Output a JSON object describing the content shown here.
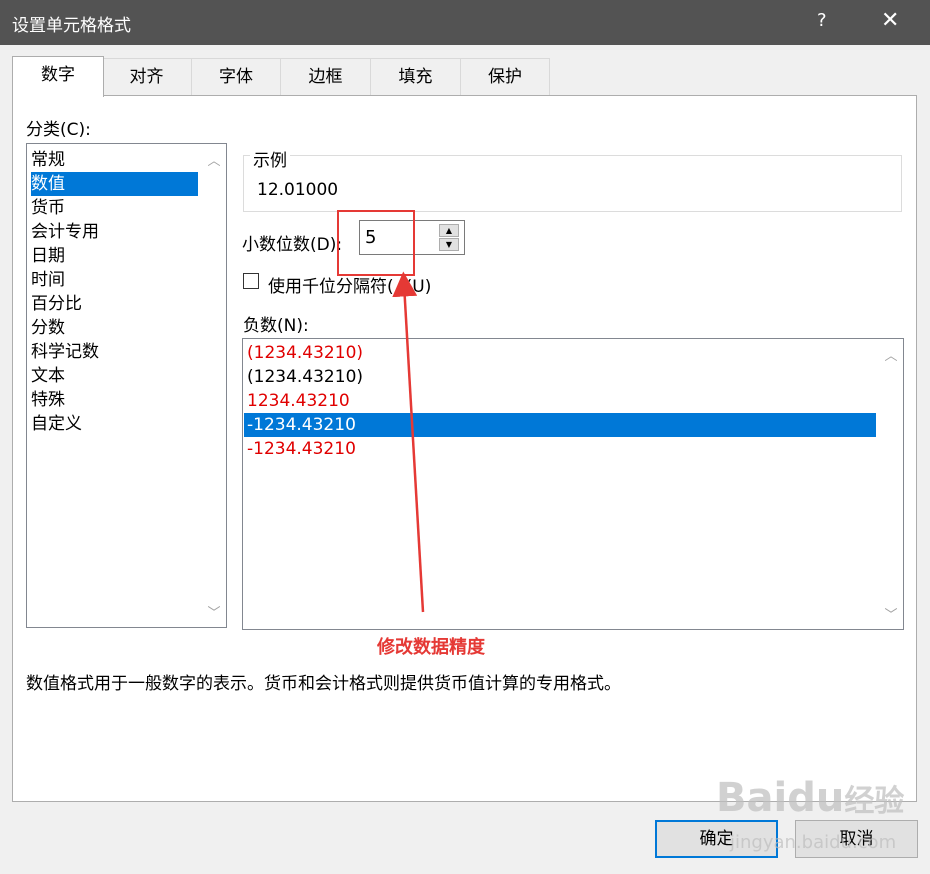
{
  "window": {
    "title": "设置单元格格式",
    "help": "?",
    "close": "✕"
  },
  "tabs": [
    "数字",
    "对齐",
    "字体",
    "边框",
    "填充",
    "保护"
  ],
  "category": {
    "label": "分类(C):",
    "items": [
      "常规",
      "数值",
      "货币",
      "会计专用",
      "日期",
      "时间",
      "百分比",
      "分数",
      "科学记数",
      "文本",
      "特殊",
      "自定义"
    ],
    "selected_index": 1
  },
  "sample": {
    "label": "示例",
    "value": "12.01000"
  },
  "decimal": {
    "label": "小数位数(D):",
    "value": "5"
  },
  "thousands": {
    "label": "使用千位分隔符(,)(U)",
    "checked": false
  },
  "negative": {
    "label": "负数(N):",
    "items": [
      {
        "text": "(1234.43210)",
        "color": "#e00000"
      },
      {
        "text": "(1234.43210)",
        "color": "#000000"
      },
      {
        "text": "1234.43210",
        "color": "#e00000"
      },
      {
        "text": "-1234.43210",
        "color": "#ffffff"
      },
      {
        "text": "-1234.43210",
        "color": "#e00000"
      }
    ],
    "selected_index": 3
  },
  "description": "数值格式用于一般数字的表示。货币和会计格式则提供货币值计算的专用格式。",
  "annotation": {
    "text": "修改数据精度",
    "color": "#e53935"
  },
  "buttons": {
    "ok": "确定",
    "cancel": "取消"
  },
  "watermark": {
    "brand": "Baidu",
    "suffix": "经验",
    "url": "jingyan.baidu.com"
  },
  "colors": {
    "accent": "#0078d7",
    "title_bg": "#535353",
    "negative_red": "#e00000"
  }
}
